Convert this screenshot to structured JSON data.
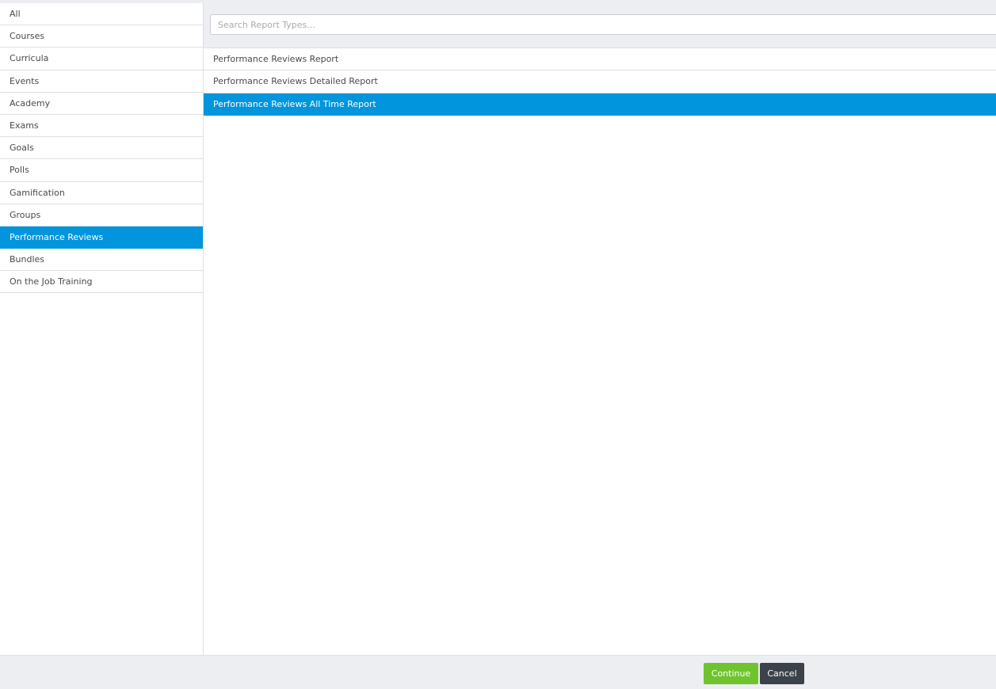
{
  "sidebar": {
    "items": [
      {
        "label": "All",
        "selected": false
      },
      {
        "label": "Courses",
        "selected": false
      },
      {
        "label": "Curricula",
        "selected": false
      },
      {
        "label": "Events",
        "selected": false
      },
      {
        "label": "Academy",
        "selected": false
      },
      {
        "label": "Exams",
        "selected": false
      },
      {
        "label": "Goals",
        "selected": false
      },
      {
        "label": "Polls",
        "selected": false
      },
      {
        "label": "Gamification",
        "selected": false
      },
      {
        "label": "Groups",
        "selected": false
      },
      {
        "label": "Performance Reviews",
        "selected": true
      },
      {
        "label": "Bundles",
        "selected": false
      },
      {
        "label": "On the Job Training",
        "selected": false
      }
    ]
  },
  "search": {
    "placeholder": "Search Report Types...",
    "value": ""
  },
  "reports": {
    "items": [
      {
        "label": "Performance Reviews Report",
        "selected": false
      },
      {
        "label": "Performance Reviews Detailed Report",
        "selected": false
      },
      {
        "label": "Performance Reviews All Time Report",
        "selected": true
      }
    ]
  },
  "footer": {
    "continue_label": "Continue",
    "cancel_label": "Cancel"
  },
  "colors": {
    "accent": "#0095dd",
    "continue": "#6fc42e",
    "cancel": "#3b4249",
    "panel_bg": "#edeef2"
  }
}
